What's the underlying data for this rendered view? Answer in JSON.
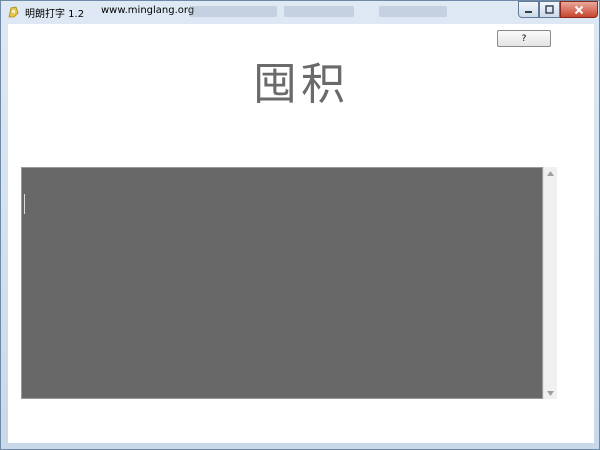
{
  "window": {
    "title": "明朗打字 1.2",
    "url": "www.minglang.org"
  },
  "toolbar": {
    "help_label": "?"
  },
  "display": {
    "characters": "囤积"
  },
  "icons": {
    "app": "app-icon",
    "minimize": "minimize-icon",
    "maximize": "maximize-icon",
    "close": "close-icon",
    "scroll_up": "scroll-up-icon",
    "scroll_down": "scroll-down-icon"
  },
  "colors": {
    "text_area_bg": "#686868",
    "glyph": "#6a6a6a",
    "close_button": "#c8452f"
  }
}
